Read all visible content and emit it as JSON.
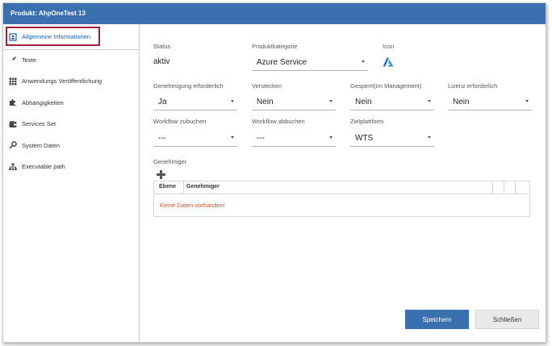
{
  "window": {
    "title": "Produkt: AhpOneTest 13"
  },
  "sidebar": {
    "items": [
      {
        "label": "Allgemeine Informationen",
        "icon": "id-card-icon",
        "active": true
      },
      {
        "label": "Texte",
        "icon": "feather-icon"
      },
      {
        "label": "Anwendungs Veröffentlichung",
        "icon": "grid-icon"
      },
      {
        "label": "Abhängigkeiten",
        "icon": "puzzle-icon"
      },
      {
        "label": "Services Set",
        "icon": "wallet-icon"
      },
      {
        "label": "System Daten",
        "icon": "key-icon"
      },
      {
        "label": "Executable path",
        "icon": "hierarchy-icon"
      }
    ]
  },
  "form": {
    "status_label": "Status",
    "status_value": "aktiv",
    "produktkategorie_label": "Produktkategorie",
    "produktkategorie_value": "Azure Service",
    "icon_label": "Icon",
    "icon_name": "azure-logo-icon",
    "genehmigung_label": "Genehmigung erforderlich",
    "genehmigung_value": "Ja",
    "verstecken_label": "Verstecken",
    "verstecken_value": "Nein",
    "gesperrt_label": "Gesperrt(Im Management)",
    "gesperrt_value": "Nein",
    "lizenz_label": "Lizenz erforderlich",
    "lizenz_value": "Nein",
    "workflow_zubuchen_label": "Workflow zubuchen",
    "workflow_zubuchen_value": "---",
    "workflow_abbuchen_label": "Workflow abbuchen",
    "workflow_abbuchen_value": "---",
    "zielplattform_label": "Zielplattform",
    "zielplattform_value": "WTS"
  },
  "approvers": {
    "title": "Genehmiger",
    "columns": [
      "Ebene",
      "Genehmiger"
    ],
    "empty_text": "Keine Daten vorhanden!"
  },
  "footer": {
    "save_label": "Speichern",
    "close_label": "Schließen"
  },
  "colors": {
    "accent": "#3a6fb0",
    "highlight_border": "#a41d3a",
    "empty_text": "#d9532b"
  }
}
